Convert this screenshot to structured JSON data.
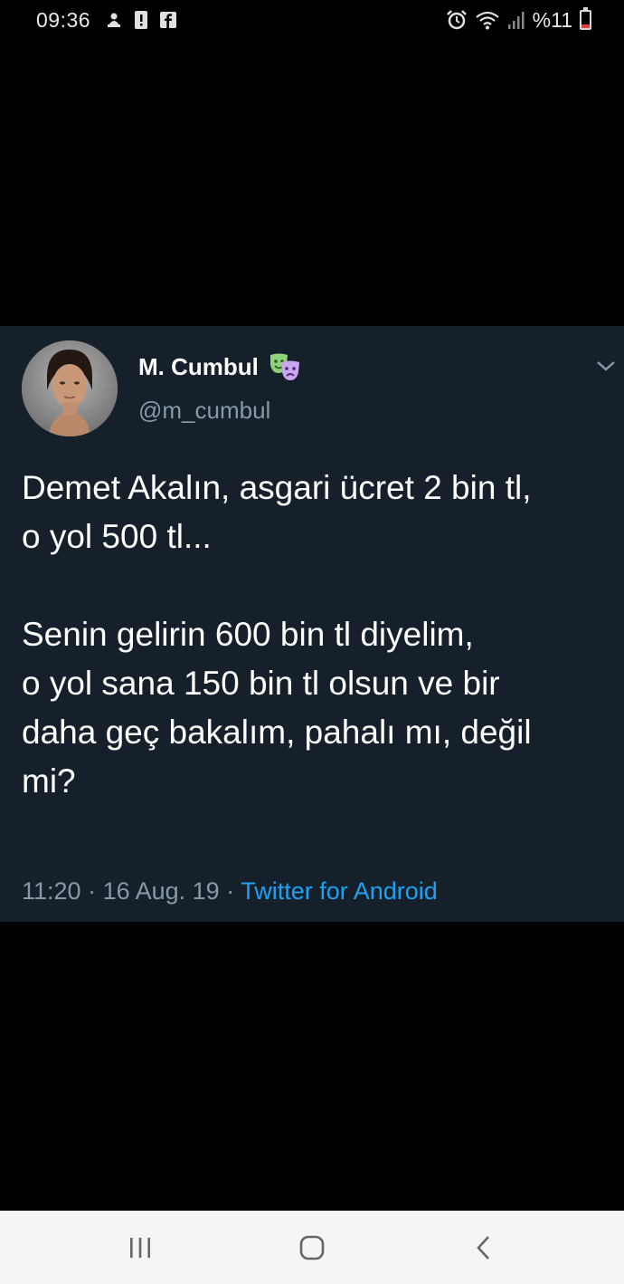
{
  "status_bar": {
    "time": "09:36",
    "left_icons": [
      "usb-debug-icon",
      "alert-icon",
      "facebook-icon"
    ],
    "right_icons": [
      "alarm-icon",
      "wifi-icon",
      "signal-icon"
    ],
    "battery_text": "%11",
    "battery_low_color": "#e53935"
  },
  "tweet": {
    "display_name": "M. Cumbul",
    "name_badge_icon": "theater-masks-icon",
    "handle": "@m_cumbul",
    "text_lines": [
      "Demet Akalın, asgari ücret 2 bin tl,",
      "o yol 500 tl...",
      "",
      "Senin gelirin 600 bin tl diyelim,",
      "o yol sana 150 bin tl olsun ve bir",
      "daha geç bakalım, pahalı mı, değil",
      "mi?"
    ],
    "time": "11:20",
    "date": "16 Aug. 19",
    "source": "Twitter for Android",
    "separator": " · ",
    "background_color": "#15202b",
    "link_color": "#1da1f2"
  },
  "nav_bar": {
    "buttons": [
      "recent-apps-icon",
      "home-icon",
      "back-icon"
    ]
  }
}
